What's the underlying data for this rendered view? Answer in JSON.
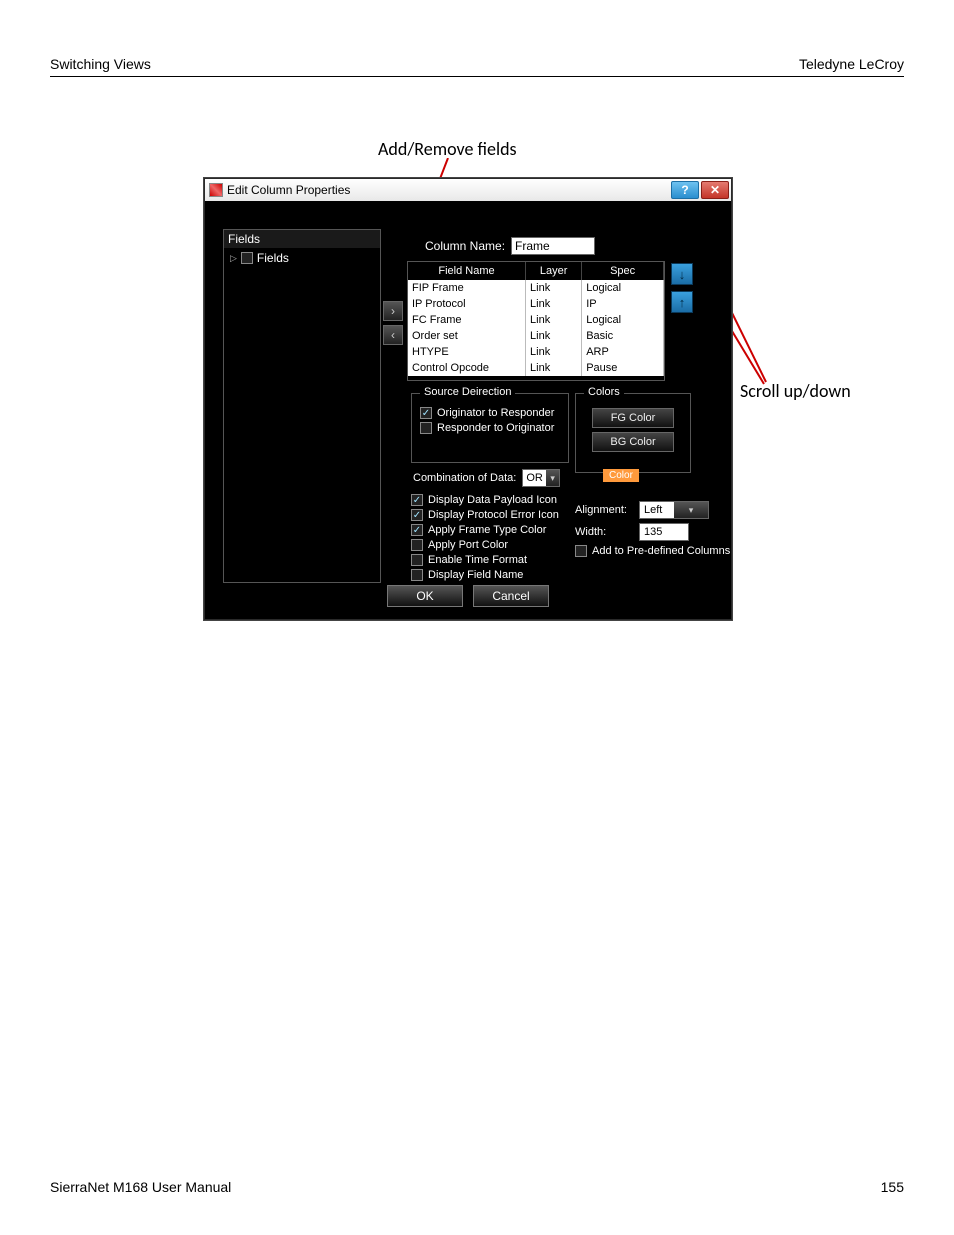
{
  "page": {
    "header_left": "Switching Views",
    "header_right": "Teledyne LeCroy",
    "footer_left": "SierraNet M168 User Manual",
    "footer_right": "155"
  },
  "callouts": {
    "top": "Add/Remove fields",
    "right": "Scroll up/down"
  },
  "dialog": {
    "title": "Edit Column Properties",
    "help_glyph": "?",
    "close_glyph": "✕",
    "left_panel": {
      "header": "Fields",
      "tree_item": "Fields"
    },
    "column_name_label": "Column Name:",
    "column_name_value": "Frame",
    "table": {
      "headers": [
        "Field Name",
        "Layer",
        "Spec"
      ],
      "rows": [
        {
          "name": "FIP Frame",
          "layer": "Link",
          "spec": "Logical"
        },
        {
          "name": "IP Protocol",
          "layer": "Link",
          "spec": "IP"
        },
        {
          "name": "FC Frame",
          "layer": "Link",
          "spec": "Logical"
        },
        {
          "name": "Order set",
          "layer": "Link",
          "spec": "Basic"
        },
        {
          "name": "HTYPE",
          "layer": "Link",
          "spec": "ARP"
        },
        {
          "name": "Control Opcode",
          "layer": "Link",
          "spec": "Pause"
        }
      ]
    },
    "arrows": {
      "add": "›",
      "remove": "‹",
      "down": "↓",
      "up": "↑"
    },
    "source_direction": {
      "legend": "Source Deirection",
      "orig_to_resp": "Originator to Responder",
      "resp_to_orig": "Responder to Originator"
    },
    "colors": {
      "legend": "Colors",
      "fg": "FG Color",
      "bg": "BG Color",
      "swatch_label": "Color"
    },
    "combination": {
      "label": "Combination of Data:",
      "value": "OR"
    },
    "options": {
      "payload_icon": "Display Data Payload Icon",
      "protocol_error_icon": "Display Protocol Error Icon",
      "frame_type_color": "Apply Frame Type Color",
      "port_color": "Apply Port Color",
      "time_format": "Enable Time Format",
      "field_name": "Display Field Name"
    },
    "alignment": {
      "label": "Alignment:",
      "value": "Left"
    },
    "width": {
      "label": "Width:",
      "value": "135"
    },
    "predef": "Add to Pre-defined Columns",
    "buttons": {
      "ok": "OK",
      "cancel": "Cancel"
    }
  }
}
